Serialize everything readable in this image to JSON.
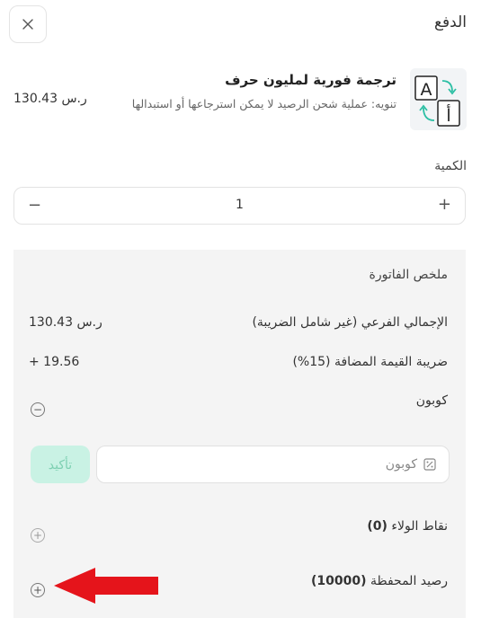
{
  "header": {
    "title": "الدفع",
    "close_icon": "close-icon"
  },
  "product": {
    "name": "ترجمة فورية لمليون حرف",
    "note": "تنويه: عملية شحن الرصيد لا يمكن استرجاعها أو استبدالها",
    "price": "130.43 ر.س",
    "icon": "translate-icon",
    "icon_letter_latin": "A",
    "icon_letter_arabic": "أ"
  },
  "quantity": {
    "label": "الكمية",
    "value": "1",
    "minus": "−",
    "plus": "+"
  },
  "summary": {
    "title": "ملخص الفاتورة",
    "subtotal_label": "الإجمالي الفرعي (غير شامل الضريبة)",
    "subtotal_value": "130.43 ر.س",
    "vat_label": "ضريبة القيمة المضافة (15%)",
    "vat_value": "+ 19.56",
    "coupon_label": "كوبون",
    "coupon_toggle": "−",
    "coupon_placeholder": "كوبون",
    "confirm_label": "تأكيد",
    "loyalty_label": "نقاط الولاء",
    "loyalty_value": "(0)",
    "wallet_label": "رصيد المحفظة",
    "wallet_value": "(10000)",
    "expand": "+"
  },
  "colors": {
    "accent_light": "#c9f2e4",
    "accent_text": "#7ed0b2",
    "arrow": "#e5141b",
    "panel": "#f4f4f4"
  }
}
